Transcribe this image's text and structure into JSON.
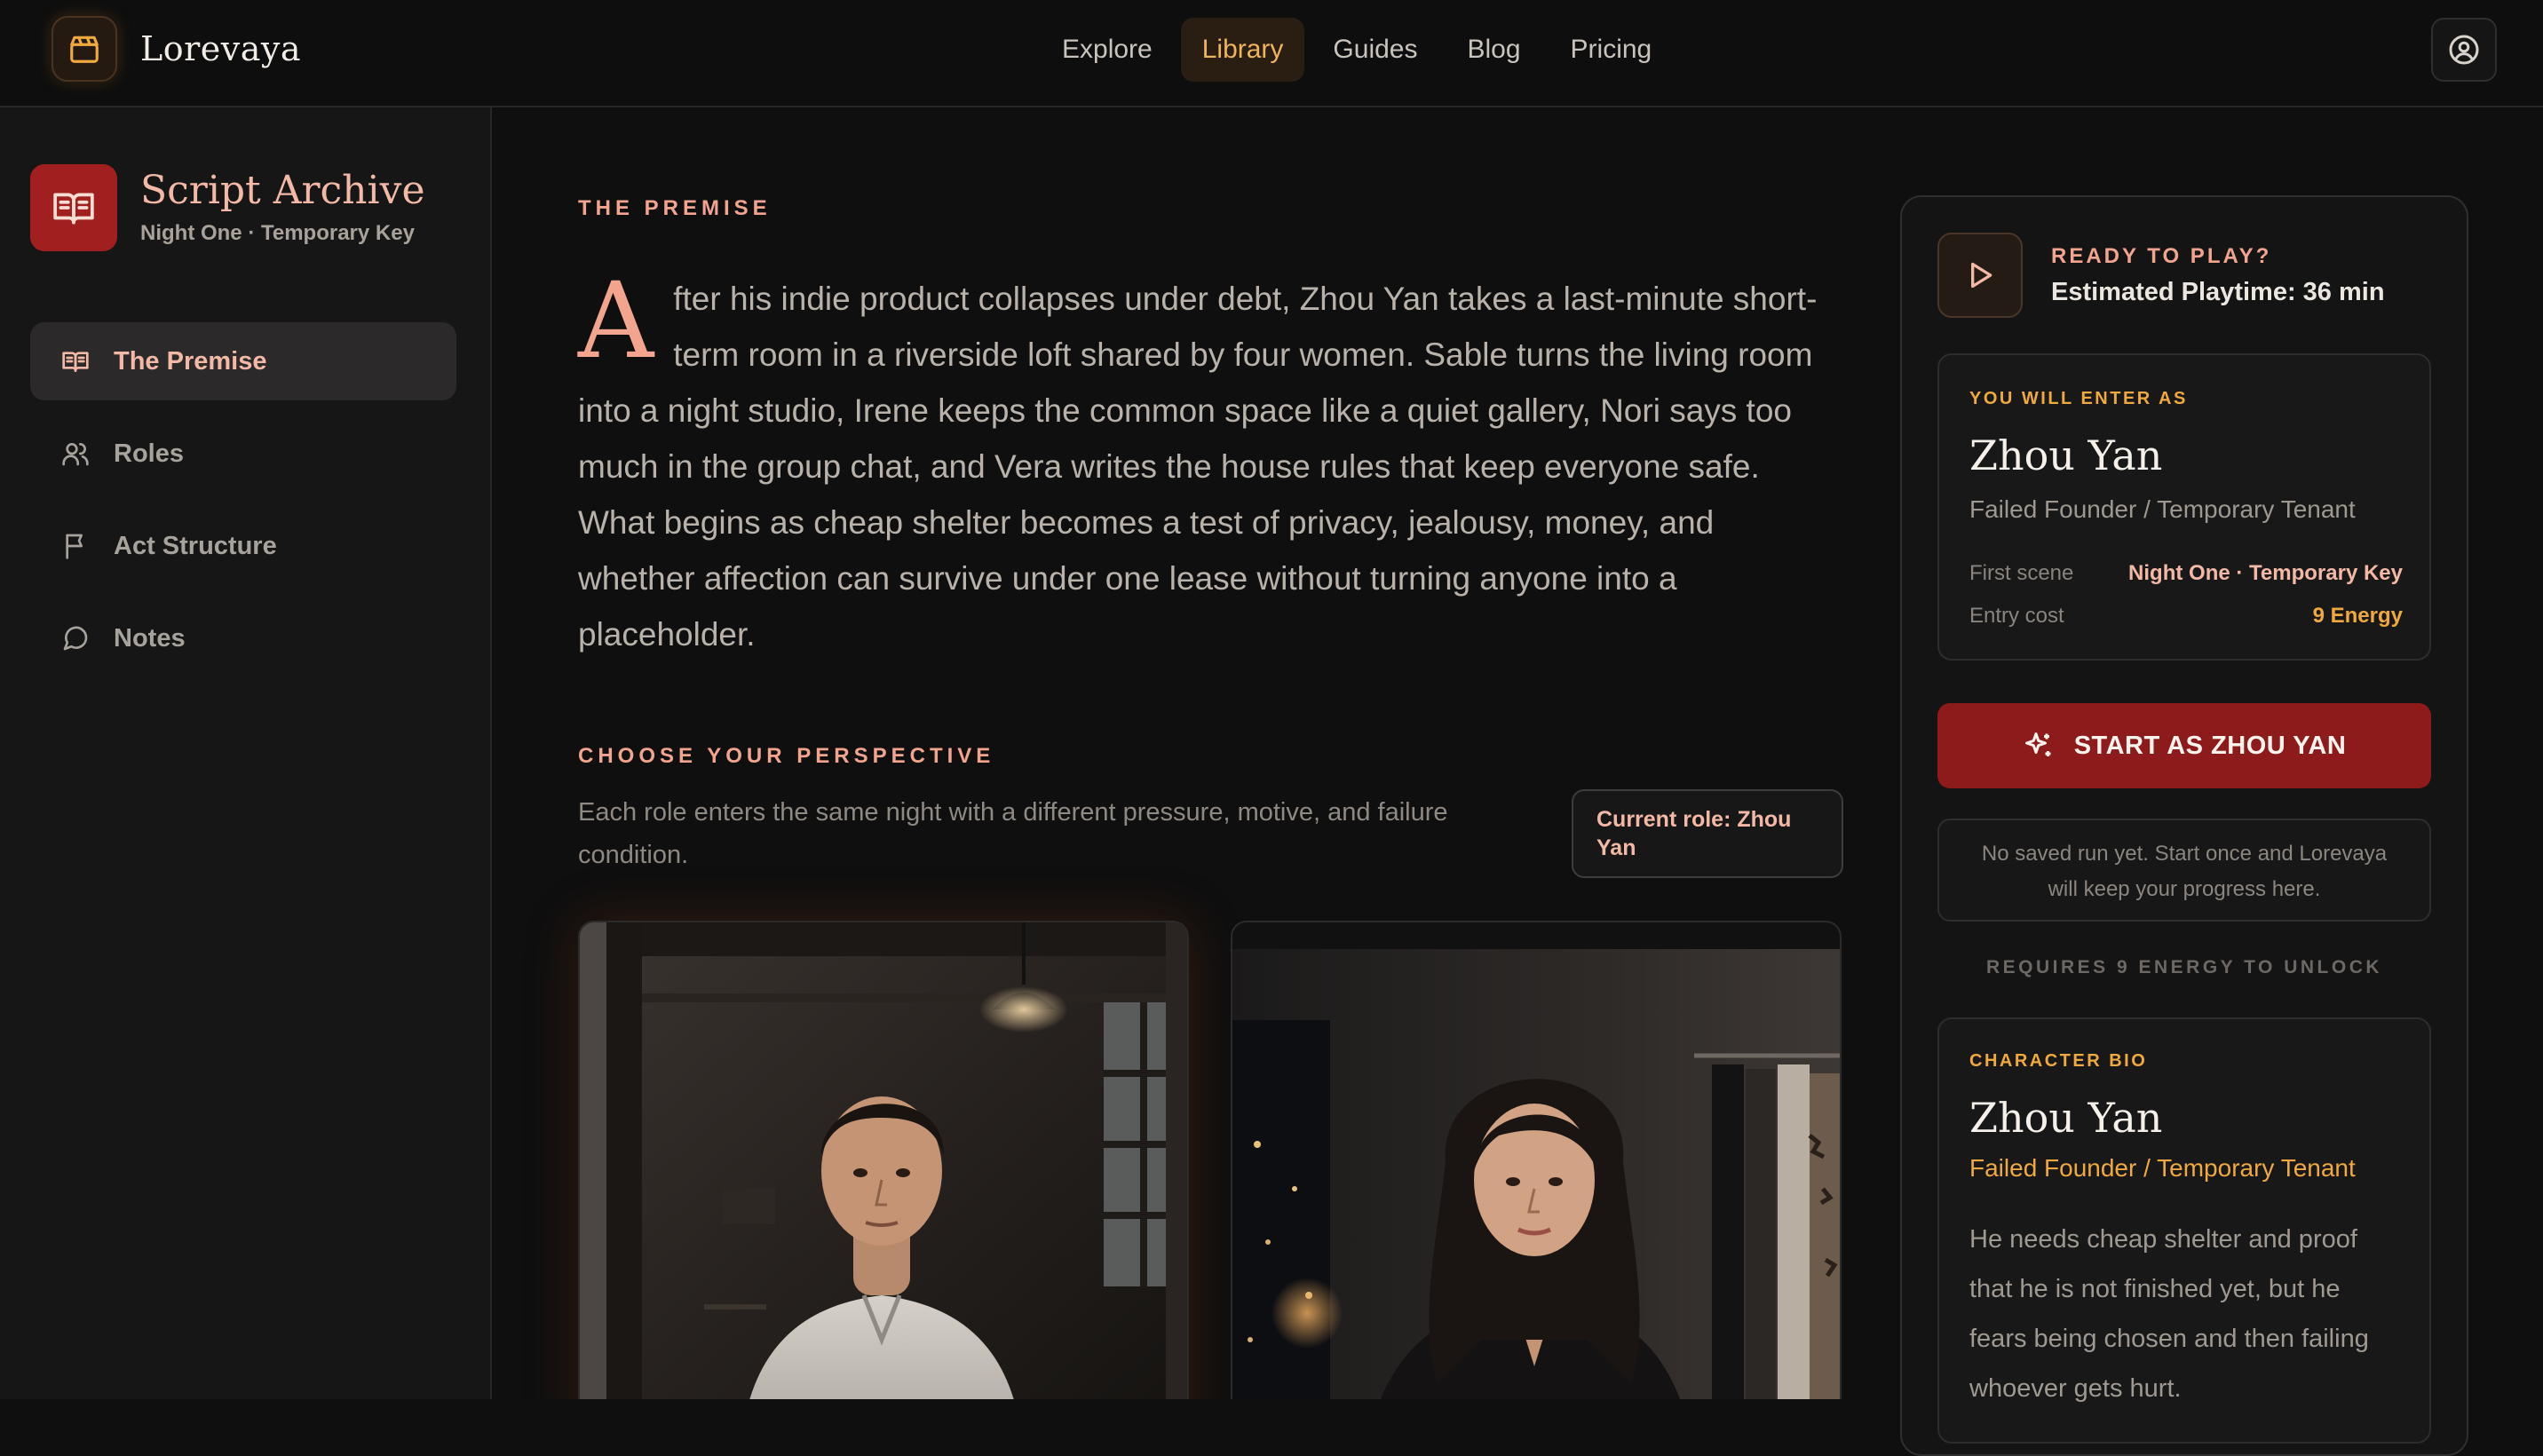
{
  "app": {
    "name": "Lorevaya"
  },
  "nav": {
    "items": [
      {
        "label": "Explore",
        "active": false
      },
      {
        "label": "Library",
        "active": true
      },
      {
        "label": "Guides",
        "active": false
      },
      {
        "label": "Blog",
        "active": false
      },
      {
        "label": "Pricing",
        "active": false
      }
    ]
  },
  "sidebar": {
    "title": "Script Archive",
    "subtitle": "Night One · Temporary Key",
    "items": [
      {
        "label": "The Premise",
        "icon": "book-open-icon",
        "active": true
      },
      {
        "label": "Roles",
        "icon": "users-icon",
        "active": false
      },
      {
        "label": "Act Structure",
        "icon": "flag-icon",
        "active": false
      },
      {
        "label": "Notes",
        "icon": "chat-bubble-icon",
        "active": false
      }
    ]
  },
  "premise": {
    "label": "THE PREMISE",
    "drop_cap": "A",
    "body": "fter his indie product collapses under debt, Zhou Yan takes a last-minute short-term room in a riverside loft shared by four women. Sable turns the living room into a night studio, Irene keeps the common space like a quiet gallery, Nori says too much in the group chat, and Vera writes the house rules that keep everyone safe. What begins as cheap shelter becomes a test of privacy, jealousy, money, and whether affection can survive under one lease without turning anyone into a placeholder."
  },
  "perspective": {
    "label": "CHOOSE YOUR PERSPECTIVE",
    "description": "Each role enters the same night with a different pressure, motive, and failure condition.",
    "current_role": "Current role: Zhou Yan"
  },
  "panel": {
    "ready_label": "READY TO PLAY?",
    "playtime": "Estimated Playtime: 36 min",
    "enter_label": "YOU WILL ENTER AS",
    "character_name": "Zhou Yan",
    "character_role": "Failed Founder / Temporary Tenant",
    "first_scene_key": "First scene",
    "first_scene_value": "Night One · Temporary Key",
    "entry_cost_key": "Entry cost",
    "entry_cost_value": "9 Energy",
    "start_button": "START AS ZHOU YAN",
    "no_saved_run": "No saved run yet. Start once and Lorevaya will keep your progress here.",
    "requires": "REQUIRES 9 ENERGY TO UNLOCK",
    "bio_label": "CHARACTER BIO",
    "bio_name": "Zhou Yan",
    "bio_role": "Failed Founder / Temporary Tenant",
    "bio_text": "He needs cheap shelter and proof that he is not finished yet, but he fears being chosen and then failing whoever gets hurt."
  },
  "colors": {
    "accent_red": "#8e1b1b",
    "accent_salmon": "#f3a48e",
    "accent_gold": "#f0a93f",
    "background": "#0f0f0f"
  }
}
